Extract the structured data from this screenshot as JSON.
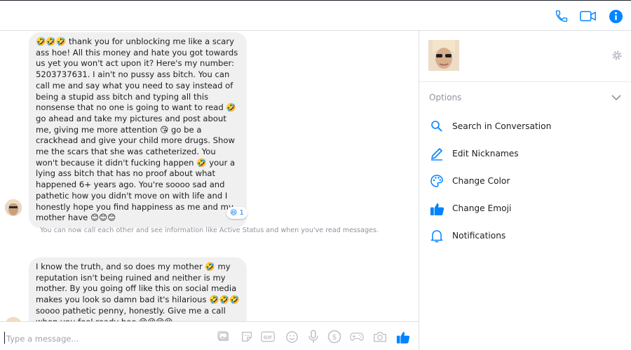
{
  "header": {
    "icons": [
      "phone-icon",
      "video-camera-icon",
      "info-icon"
    ],
    "accent_color": "#0084ff"
  },
  "messages": [
    {
      "sender": "other",
      "text": "🤣🤣🤣 thank you for unblocking me like a scary ass hoe! All this money and hate you got towards us yet you won't act upon it? Here's my number: 5203737631. I ain't no pussy ass bitch. You can call me and say what you need to say instead of being a stupid ass bitch and typing all this nonsense that no one is going to want to read 🤣 go ahead and take my pictures and post about me, giving me more attention 😘 go be a crackhead and give your child more drugs. Show me the scars that she was catheterized. You won't because it didn't fucking happen 🤣 your a lying ass bitch that has no proof about what happened 6+ years ago. You're soooo sad and pathetic how you didn't move on with life and I honestly hope you find happiness as me and my mother have 😊😊😊",
      "reaction": {
        "emoji": "😆",
        "count": "1"
      }
    },
    {
      "sender": "other",
      "text": "I know the truth, and so does my mother 🤣 my reputation isn't being ruined and neither is my mother. By you going off like this on social media makes you look so damn bad it's hilarious 🤣🤣🤣 soooo pathetic penny, honestly. Give me a call when you feel ready boo 😘😘😘😘"
    }
  ],
  "system_message": "You can now call each other and see information like Active Status and when you've read messages.",
  "composer": {
    "placeholder": "Type a message...",
    "icons": [
      "image-icon",
      "sticker-icon",
      "gif-icon",
      "emoji-icon",
      "microphone-icon",
      "dollar-icon",
      "game-controller-icon",
      "camera-icon",
      "thumbs-up-icon"
    ]
  },
  "sidebar": {
    "options_label": "Options",
    "items": [
      {
        "label": "Search in Conversation",
        "icon": "search-icon"
      },
      {
        "label": "Edit Nicknames",
        "icon": "pencil-icon"
      },
      {
        "label": "Change Color",
        "icon": "palette-icon"
      },
      {
        "label": "Change Emoji",
        "icon": "thumbs-up-icon"
      },
      {
        "label": "Notifications",
        "icon": "bell-icon"
      }
    ]
  }
}
